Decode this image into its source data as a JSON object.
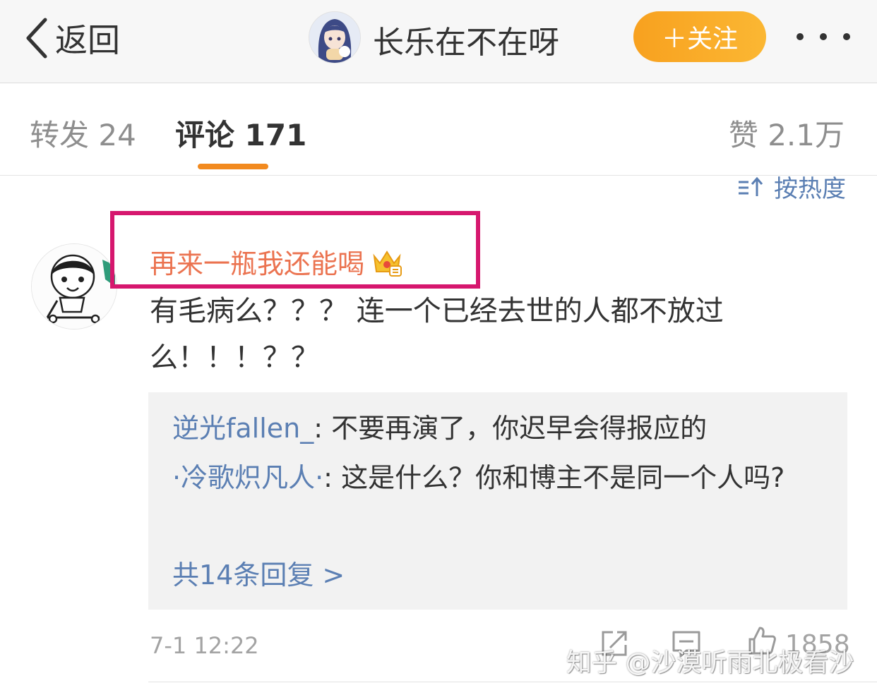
{
  "header": {
    "back_label": "返回",
    "user_name": "长乐在不在呀",
    "follow_label": "＋关注",
    "more_icon": "more-dots-icon"
  },
  "tabs": {
    "repost": "转发 24",
    "comments": "评论 171",
    "likes": "赞 2.1万",
    "active": "comments"
  },
  "sort": {
    "label": "按热度",
    "icon": "sort-icon"
  },
  "comment": {
    "user": "再来一瓶我还能喝",
    "badge_icon": "crown-badge-icon",
    "text": "有毛病么？？？ 连一个已经去世的人都不放过么！！！？？",
    "replies": [
      {
        "user": "逆光fallen_",
        "separator": ": ",
        "text": "不要再演了，你迟早会得报应的"
      },
      {
        "user": "·冷歌炽凡人·",
        "separator": ": ",
        "text": "这是什么？你和博主不是同一个人吗?"
      }
    ],
    "more_replies": "共14条回复 >",
    "time": "7-1 12:22",
    "like_count": "1858"
  },
  "watermark": "知乎 @沙漠听雨北极看沙",
  "colors": {
    "username_orange": "#eb7350",
    "link_blue": "#5b7fb3",
    "follow_orange": "#f8a11f",
    "highlight_magenta": "#d6176e",
    "tab_underline": "#f28a1f"
  }
}
